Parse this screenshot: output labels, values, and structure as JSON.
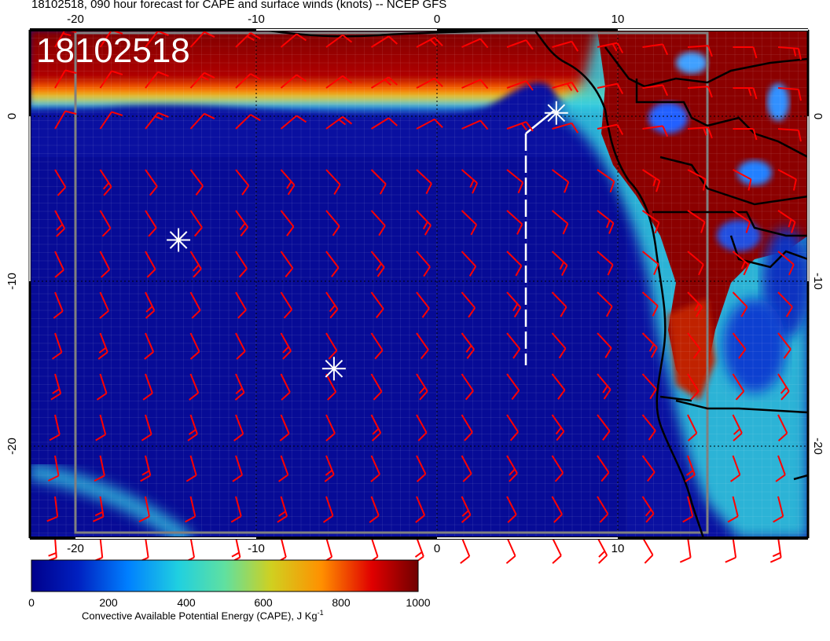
{
  "title": "18102518, 090 hour forecast for CAPE and surface winds (knots) -- NCEP GFS",
  "stamp": "18102518",
  "axes": {
    "x_ticks": [
      "-20",
      "-10",
      "0",
      "10"
    ],
    "y_ticks": [
      "0",
      "-10",
      "-20"
    ]
  },
  "colorbar": {
    "ticks": [
      "0",
      "200",
      "400",
      "600",
      "800",
      "1000"
    ],
    "label": "Convective Available Potential Energy (CAPE), J Kg",
    "label_sup": "-1",
    "colors": [
      "#00008b",
      "#0040ff",
      "#00c0ff",
      "#40e0d0",
      "#c0e040",
      "#ffc000",
      "#ff4000",
      "#c00000",
      "#7f0000"
    ]
  },
  "markers": [
    {
      "name": "marker-west",
      "lon": -14.3,
      "lat": -7.5
    },
    {
      "name": "marker-south",
      "lon": -5.7,
      "lat": -15.3
    },
    {
      "name": "marker-north",
      "lon": 6.6,
      "lat": 0.2
    }
  ],
  "track_color": "#ffffff",
  "barb_color": "#ff0000",
  "colors": {
    "ocean": "#00008b",
    "land_hot": "#7f0000",
    "coast": "#000000"
  }
}
